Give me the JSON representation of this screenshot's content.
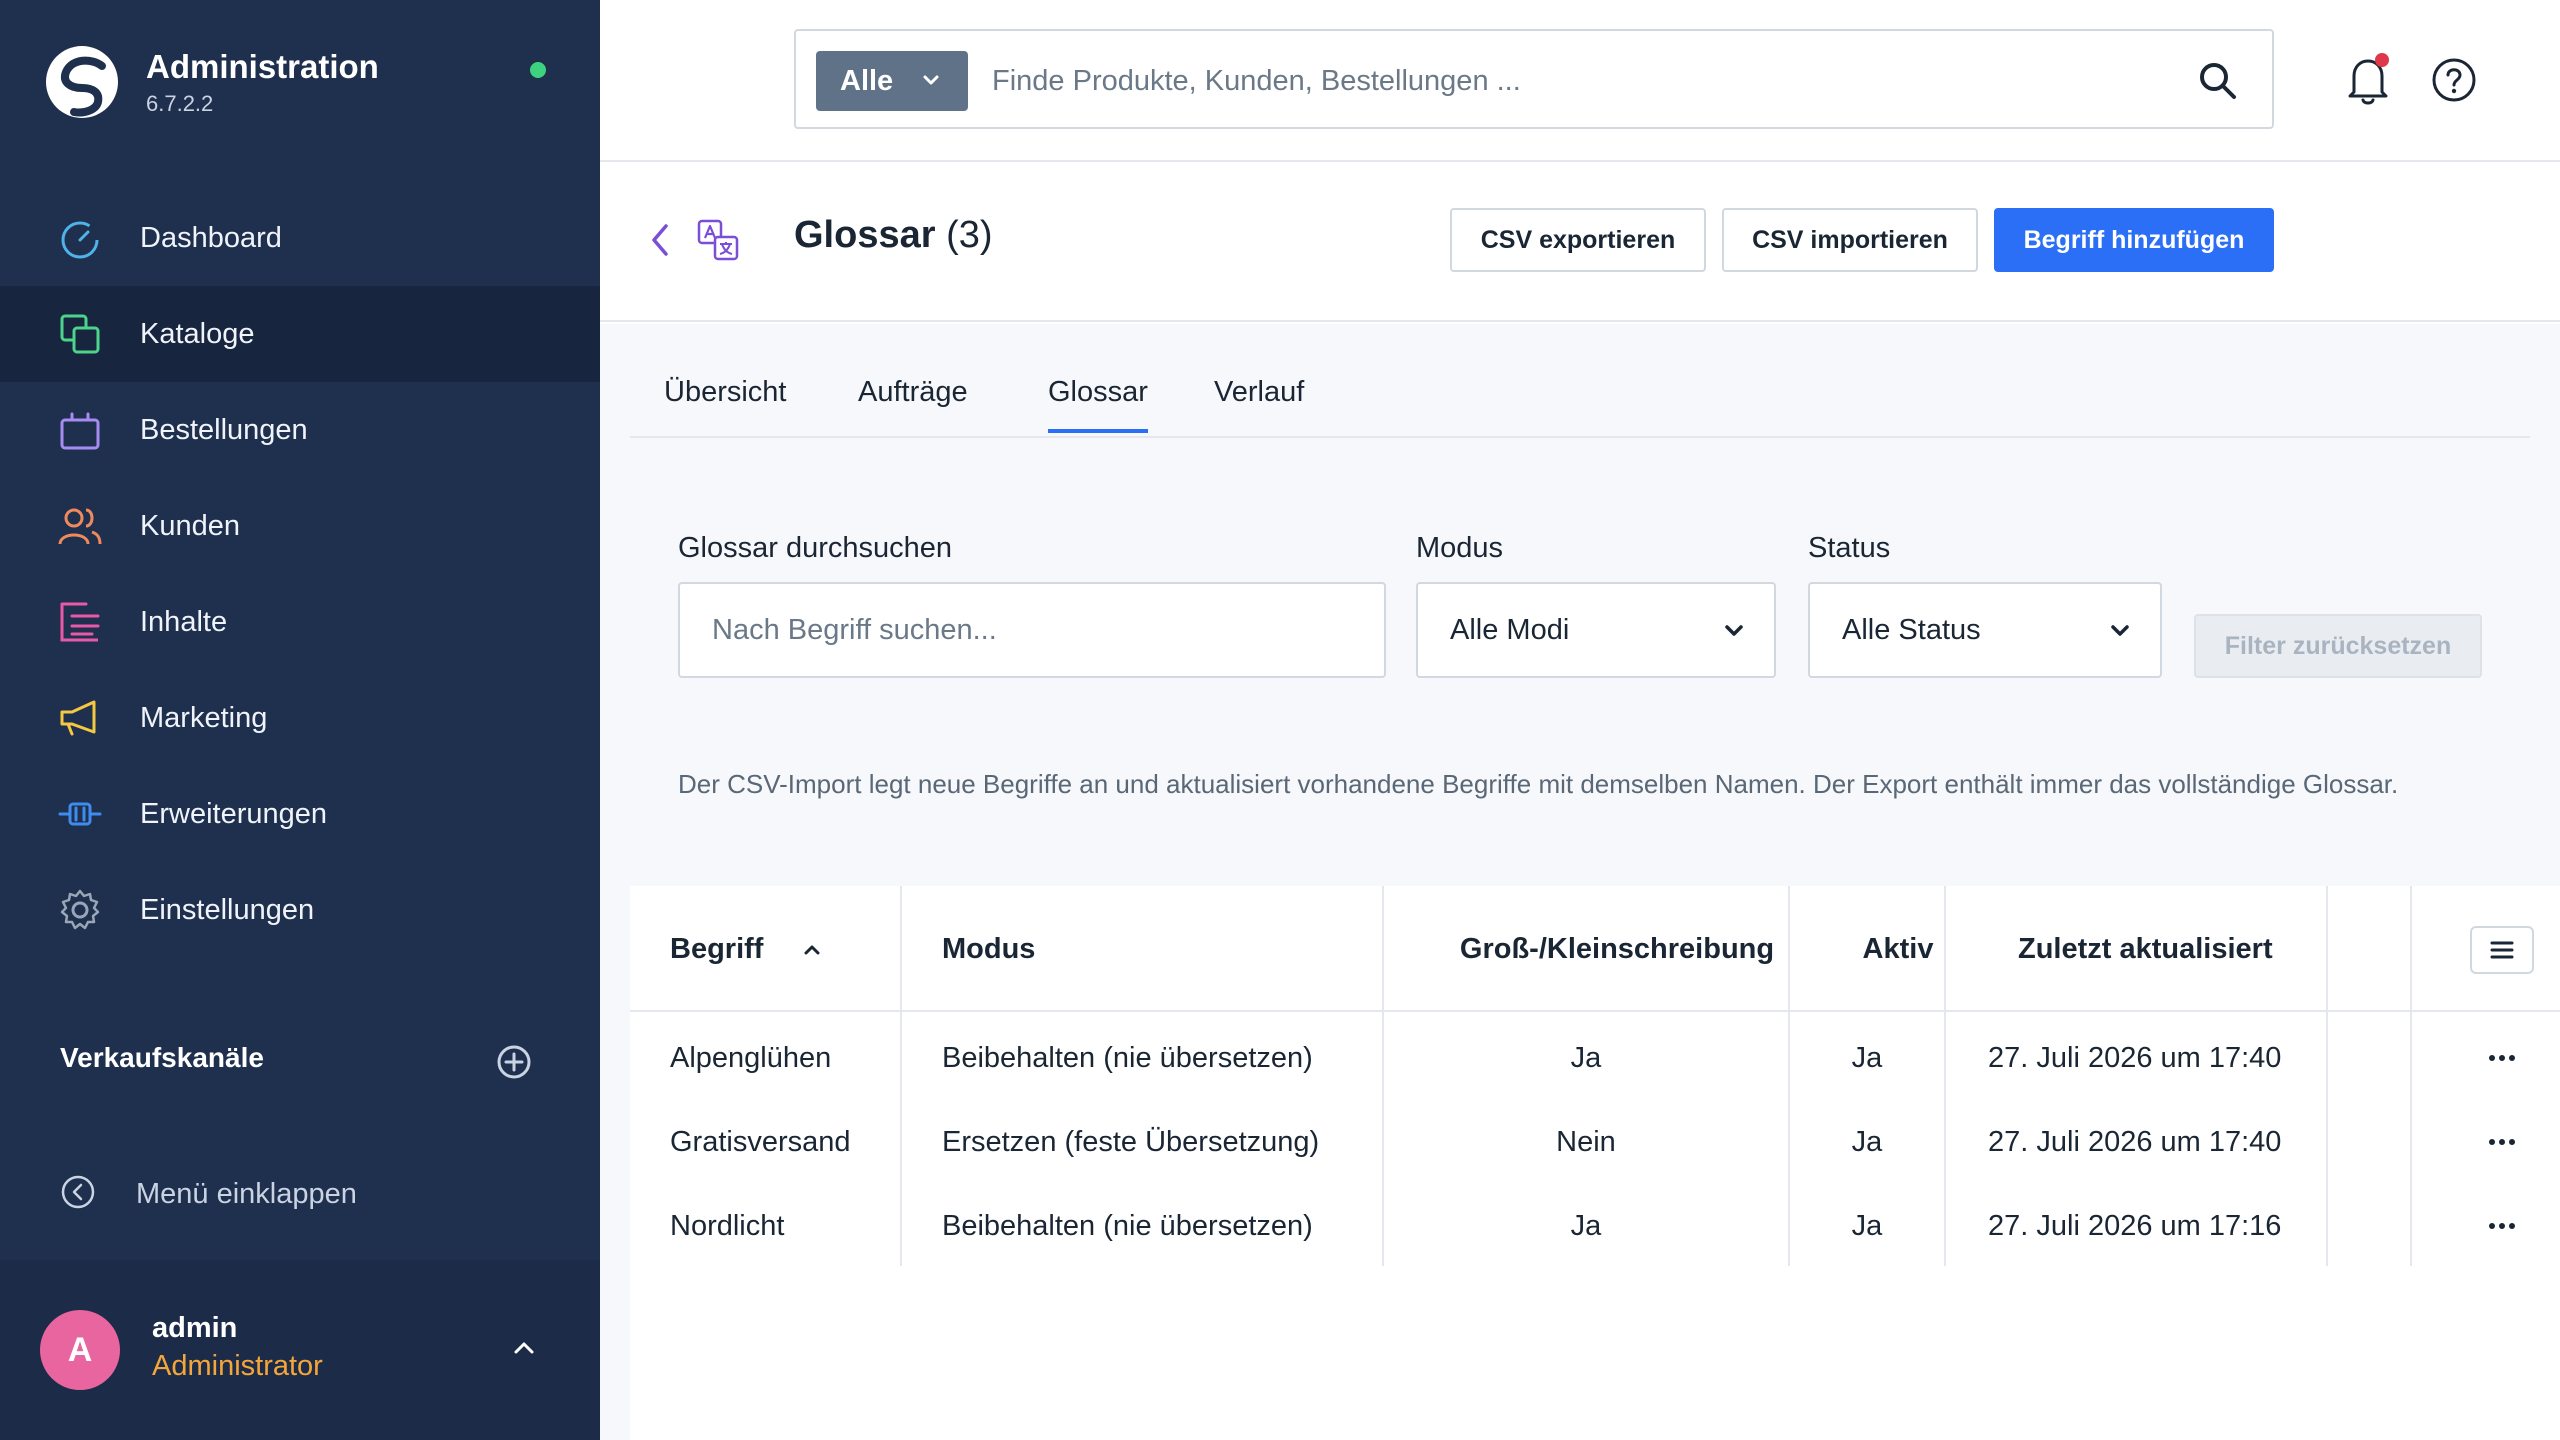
{
  "app": {
    "name": "Administration",
    "version": "6.7.2.2"
  },
  "sidebar": {
    "items": [
      {
        "label": "Dashboard",
        "icon": "dashboard-gauge-icon",
        "color": "#4fb3e8"
      },
      {
        "label": "Kataloge",
        "icon": "catalog-copy-icon",
        "color": "#4ed38a",
        "active": true
      },
      {
        "label": "Bestellungen",
        "icon": "shopping-bag-icon",
        "color": "#a58cf2"
      },
      {
        "label": "Kunden",
        "icon": "users-icon",
        "color": "#f08a5d"
      },
      {
        "label": "Inhalte",
        "icon": "content-list-icon",
        "color": "#e85aa8"
      },
      {
        "label": "Marketing",
        "icon": "megaphone-icon",
        "color": "#f5c842"
      },
      {
        "label": "Erweiterungen",
        "icon": "plug-icon",
        "color": "#3f8cf0"
      },
      {
        "label": "Einstellungen",
        "icon": "gear-icon",
        "color": "#9aa6b6"
      }
    ],
    "sales_channels_label": "Verkaufskanäle",
    "collapse_label": "Menü einklappen"
  },
  "user": {
    "initial": "A",
    "name": "admin",
    "role": "Administrator"
  },
  "search": {
    "scope": "Alle",
    "placeholder": "Finde Produkte, Kunden, Bestellungen ..."
  },
  "page": {
    "title": "Glossar",
    "count": "(3)",
    "export_label": "CSV exportieren",
    "import_label": "CSV importieren",
    "add_label": "Begriff hinzufügen"
  },
  "tabs": [
    "Übersicht",
    "Aufträge",
    "Glossar",
    "Verlauf"
  ],
  "filters": {
    "search_label": "Glossar durchsuchen",
    "search_placeholder": "Nach Begriff suchen...",
    "mode_label": "Modus",
    "mode_value": "Alle Modi",
    "status_label": "Status",
    "status_value": "Alle Status",
    "reset_label": "Filter zurücksetzen"
  },
  "info_text": "Der CSV-Import legt neue Begriffe an und aktualisiert vorhandene Begriffe mit demselben Namen. Der Export enthält immer das vollständige Glossar.",
  "table": {
    "columns": [
      "Begriff",
      "Modus",
      "Groß-/Kleinschreibung",
      "Aktiv",
      "Zuletzt aktualisiert"
    ],
    "rows": [
      [
        "Alpenglühen",
        "Beibehalten (nie übersetzen)",
        "Ja",
        "Ja",
        "27. Juli 2026 um 17:40"
      ],
      [
        "Gratisversand",
        "Ersetzen (feste Übersetzung)",
        "Nein",
        "Ja",
        "27. Juli 2026 um 17:40"
      ],
      [
        "Nordlicht",
        "Beibehalten (nie übersetzen)",
        "Ja",
        "Ja",
        "27. Juli 2026 um 17:16"
      ]
    ]
  },
  "colors": {
    "sidebar_bg": "#1f2f4e",
    "primary": "#2a6ff5",
    "status_online": "#3fd27e",
    "notification_dot": "#e0384b",
    "role": "#f5a63b",
    "avatar": "#e9659f"
  }
}
